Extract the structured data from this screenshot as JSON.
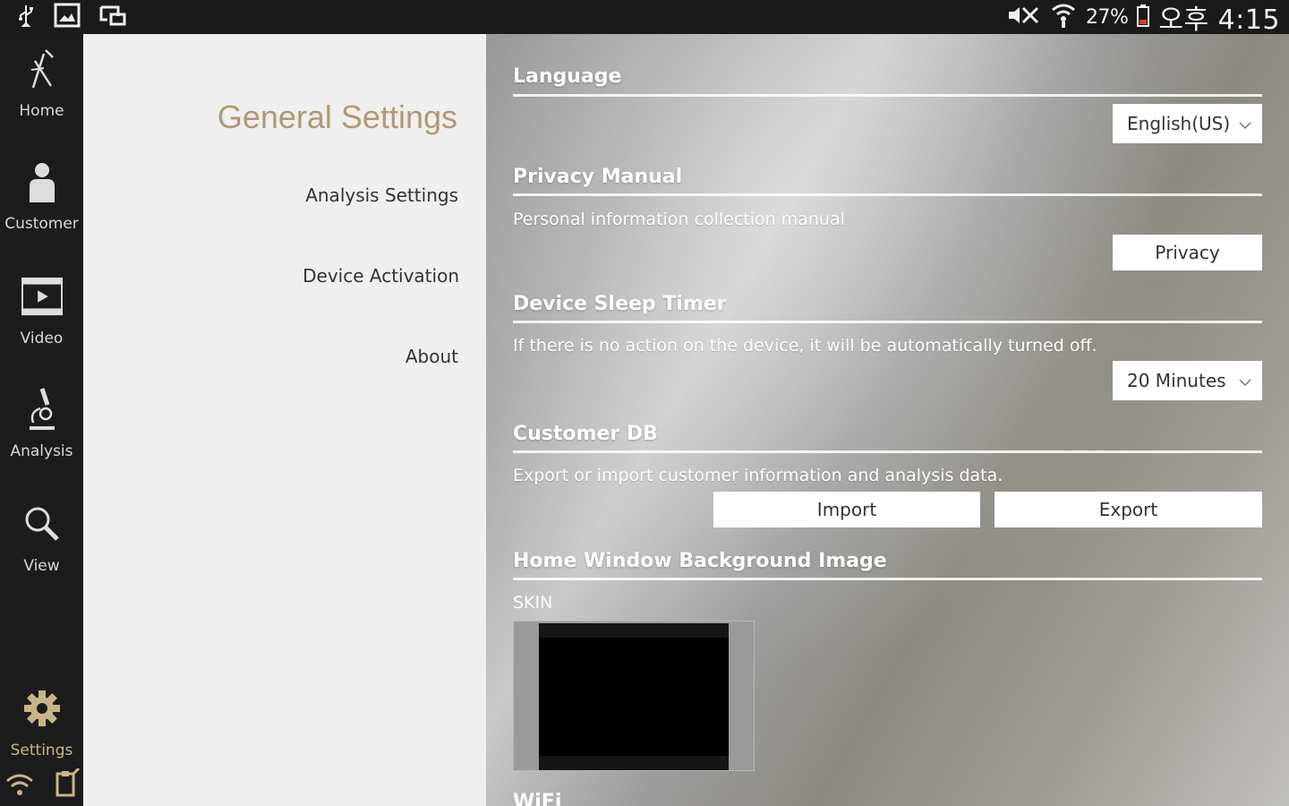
{
  "status_bar": {
    "battery_percent": "27%",
    "time": "오후 4:15",
    "left_icons": [
      "usb-icon",
      "gallery-icon",
      "screen-mirror-icon"
    ],
    "right_icons": [
      "mute-icon",
      "wifi-icon",
      "battery-icon"
    ]
  },
  "nav": {
    "items": [
      {
        "label": "Home",
        "icon": "home-icon"
      },
      {
        "label": "Customer",
        "icon": "customer-icon"
      },
      {
        "label": "Video",
        "icon": "video-icon"
      },
      {
        "label": "Analysis",
        "icon": "microscope-icon"
      },
      {
        "label": "View",
        "icon": "search-icon"
      },
      {
        "label": "Settings",
        "icon": "gear-icon"
      }
    ],
    "active": "Settings"
  },
  "menu": {
    "title": "General Settings",
    "items": [
      {
        "label": "Analysis Settings"
      },
      {
        "label": "Device Activation"
      },
      {
        "label": "About"
      }
    ]
  },
  "sections": {
    "language": {
      "title": "Language",
      "selected": "English(US)"
    },
    "privacy": {
      "title": "Privacy Manual",
      "description": "Personal information collection manual",
      "button": "Privacy"
    },
    "sleep": {
      "title": "Device Sleep Timer",
      "description": "If there is no action on the device, it will be automatically turned off.",
      "selected": "20 Minutes"
    },
    "customer_db": {
      "title": "Customer DB",
      "description": "Export or import customer information and analysis data.",
      "import_label": "Import",
      "export_label": "Export"
    },
    "background": {
      "title": "Home Window Background Image",
      "skin_label": "SKIN"
    },
    "wifi": {
      "title": "WiFi"
    }
  },
  "colors": {
    "accent": "#c9b38a",
    "menu_title": "#b09a74",
    "rail_bg": "#1c1c1c",
    "menu_bg": "#efefef"
  }
}
